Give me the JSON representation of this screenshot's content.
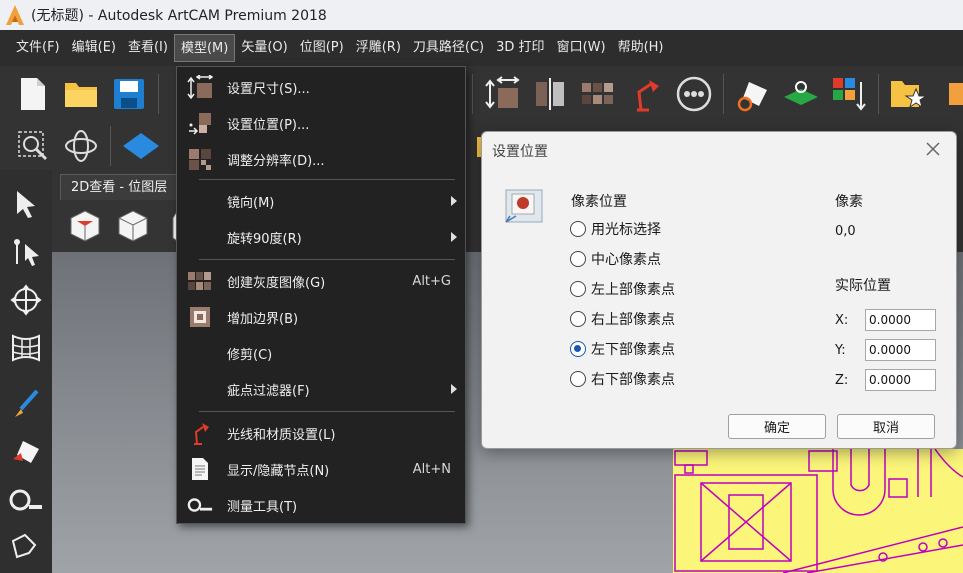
{
  "window": {
    "title": "(无标题) - Autodesk ArtCAM Premium 2018",
    "app_icon": "artcam-logo-icon",
    "accent": "#f2a03d"
  },
  "menubar": {
    "items": [
      "文件(F)",
      "编辑(E)",
      "查看(I)",
      "模型(M)",
      "矢量(O)",
      "位图(P)",
      "浮雕(R)",
      "刀具路径(C)",
      "3D 打印",
      "窗口(W)",
      "帮助(H)"
    ],
    "active_index": 3
  },
  "view": {
    "tab_label": "2D查看 - 位图层"
  },
  "model_menu": {
    "items": [
      {
        "label": "设置尺寸(S)...",
        "shortcut": "",
        "submenu": false,
        "icon": "set-size-icon"
      },
      {
        "label": "设置位置(P)...",
        "shortcut": "",
        "submenu": false,
        "icon": "set-position-icon"
      },
      {
        "label": "调整分辨率(D)...",
        "shortcut": "",
        "submenu": false,
        "icon": "resolution-icon"
      },
      {
        "label": "镜向(M)",
        "shortcut": "",
        "submenu": true,
        "icon": ""
      },
      {
        "label": "旋转90度(R)",
        "shortcut": "",
        "submenu": true,
        "icon": ""
      },
      {
        "label": "创建灰度图像(G)",
        "shortcut": "Alt+G",
        "submenu": false,
        "icon": "grayscale-icon"
      },
      {
        "label": "增加边界(B)",
        "shortcut": "",
        "submenu": false,
        "icon": "add-border-icon"
      },
      {
        "label": "修剪(C)",
        "shortcut": "",
        "submenu": false,
        "icon": ""
      },
      {
        "label": "疵点过滤器(F)",
        "shortcut": "",
        "submenu": true,
        "icon": ""
      },
      {
        "label": "光线和材质设置(L)",
        "shortcut": "",
        "submenu": false,
        "icon": "lamp-icon"
      },
      {
        "label": "显示/隐藏节点(N)",
        "shortcut": "Alt+N",
        "submenu": false,
        "icon": "document-icon"
      },
      {
        "label": "测量工具(T)",
        "shortcut": "",
        "submenu": false,
        "icon": "tape-measure-icon"
      }
    ]
  },
  "dialog": {
    "title": "设置位置",
    "pixel_position_header": "像素位置",
    "pixel_header": "像素",
    "pixel_value": "0,0",
    "actual_position_header": "实际位置",
    "options": [
      "用光标选择",
      "中心像素点",
      "左上部像素点",
      "右上部像素点",
      "左下部像素点",
      "右下部像素点"
    ],
    "selected_index": 4,
    "x_label": "X:",
    "x_value": "0.0000",
    "y_label": "Y:",
    "y_value": "0.0000",
    "z_label": "Z:",
    "z_value": "0.0000",
    "ok_label": "确定",
    "cancel_label": "取消"
  },
  "colors": {
    "menu_bg": "#222222",
    "dialog_bg": "#f2f2f2",
    "radio_selected": "#1a56b0",
    "drawing_bg": "#fbf57a",
    "drawing_lines": "#c000c0"
  }
}
